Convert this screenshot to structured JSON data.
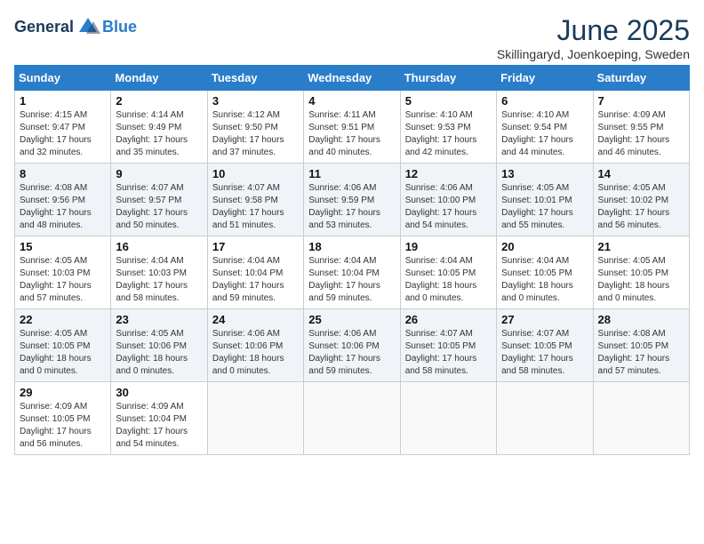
{
  "header": {
    "logo_general": "General",
    "logo_blue": "Blue",
    "month_title": "June 2025",
    "location": "Skillingaryd, Joenkoeping, Sweden"
  },
  "weekdays": [
    "Sunday",
    "Monday",
    "Tuesday",
    "Wednesday",
    "Thursday",
    "Friday",
    "Saturday"
  ],
  "weeks": [
    [
      {
        "day": "1",
        "sunrise": "4:15 AM",
        "sunset": "9:47 PM",
        "daylight": "17 hours and 32 minutes."
      },
      {
        "day": "2",
        "sunrise": "4:14 AM",
        "sunset": "9:49 PM",
        "daylight": "17 hours and 35 minutes."
      },
      {
        "day": "3",
        "sunrise": "4:12 AM",
        "sunset": "9:50 PM",
        "daylight": "17 hours and 37 minutes."
      },
      {
        "day": "4",
        "sunrise": "4:11 AM",
        "sunset": "9:51 PM",
        "daylight": "17 hours and 40 minutes."
      },
      {
        "day": "5",
        "sunrise": "4:10 AM",
        "sunset": "9:53 PM",
        "daylight": "17 hours and 42 minutes."
      },
      {
        "day": "6",
        "sunrise": "4:10 AM",
        "sunset": "9:54 PM",
        "daylight": "17 hours and 44 minutes."
      },
      {
        "day": "7",
        "sunrise": "4:09 AM",
        "sunset": "9:55 PM",
        "daylight": "17 hours and 46 minutes."
      }
    ],
    [
      {
        "day": "8",
        "sunrise": "4:08 AM",
        "sunset": "9:56 PM",
        "daylight": "17 hours and 48 minutes."
      },
      {
        "day": "9",
        "sunrise": "4:07 AM",
        "sunset": "9:57 PM",
        "daylight": "17 hours and 50 minutes."
      },
      {
        "day": "10",
        "sunrise": "4:07 AM",
        "sunset": "9:58 PM",
        "daylight": "17 hours and 51 minutes."
      },
      {
        "day": "11",
        "sunrise": "4:06 AM",
        "sunset": "9:59 PM",
        "daylight": "17 hours and 53 minutes."
      },
      {
        "day": "12",
        "sunrise": "4:06 AM",
        "sunset": "10:00 PM",
        "daylight": "17 hours and 54 minutes."
      },
      {
        "day": "13",
        "sunrise": "4:05 AM",
        "sunset": "10:01 PM",
        "daylight": "17 hours and 55 minutes."
      },
      {
        "day": "14",
        "sunrise": "4:05 AM",
        "sunset": "10:02 PM",
        "daylight": "17 hours and 56 minutes."
      }
    ],
    [
      {
        "day": "15",
        "sunrise": "4:05 AM",
        "sunset": "10:03 PM",
        "daylight": "17 hours and 57 minutes."
      },
      {
        "day": "16",
        "sunrise": "4:04 AM",
        "sunset": "10:03 PM",
        "daylight": "17 hours and 58 minutes."
      },
      {
        "day": "17",
        "sunrise": "4:04 AM",
        "sunset": "10:04 PM",
        "daylight": "17 hours and 59 minutes."
      },
      {
        "day": "18",
        "sunrise": "4:04 AM",
        "sunset": "10:04 PM",
        "daylight": "17 hours and 59 minutes."
      },
      {
        "day": "19",
        "sunrise": "4:04 AM",
        "sunset": "10:05 PM",
        "daylight": "18 hours and 0 minutes."
      },
      {
        "day": "20",
        "sunrise": "4:04 AM",
        "sunset": "10:05 PM",
        "daylight": "18 hours and 0 minutes."
      },
      {
        "day": "21",
        "sunrise": "4:05 AM",
        "sunset": "10:05 PM",
        "daylight": "18 hours and 0 minutes."
      }
    ],
    [
      {
        "day": "22",
        "sunrise": "4:05 AM",
        "sunset": "10:05 PM",
        "daylight": "18 hours and 0 minutes."
      },
      {
        "day": "23",
        "sunrise": "4:05 AM",
        "sunset": "10:06 PM",
        "daylight": "18 hours and 0 minutes."
      },
      {
        "day": "24",
        "sunrise": "4:06 AM",
        "sunset": "10:06 PM",
        "daylight": "18 hours and 0 minutes."
      },
      {
        "day": "25",
        "sunrise": "4:06 AM",
        "sunset": "10:06 PM",
        "daylight": "17 hours and 59 minutes."
      },
      {
        "day": "26",
        "sunrise": "4:07 AM",
        "sunset": "10:05 PM",
        "daylight": "17 hours and 58 minutes."
      },
      {
        "day": "27",
        "sunrise": "4:07 AM",
        "sunset": "10:05 PM",
        "daylight": "17 hours and 58 minutes."
      },
      {
        "day": "28",
        "sunrise": "4:08 AM",
        "sunset": "10:05 PM",
        "daylight": "17 hours and 57 minutes."
      }
    ],
    [
      {
        "day": "29",
        "sunrise": "4:09 AM",
        "sunset": "10:05 PM",
        "daylight": "17 hours and 56 minutes."
      },
      {
        "day": "30",
        "sunrise": "4:09 AM",
        "sunset": "10:04 PM",
        "daylight": "17 hours and 54 minutes."
      },
      null,
      null,
      null,
      null,
      null
    ]
  ]
}
